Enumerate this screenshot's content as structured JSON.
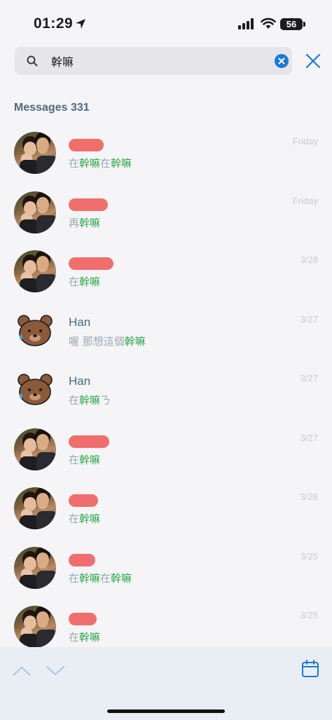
{
  "status_bar": {
    "time": "01:29",
    "battery": "56"
  },
  "search": {
    "value": "幹嘛",
    "placeholder": ""
  },
  "section": {
    "title": "Messages 331"
  },
  "messages": [
    {
      "name": "",
      "name_redacted": true,
      "avatar": "photo",
      "snippet_parts": [
        {
          "t": "在",
          "hl": false
        },
        {
          "t": "幹嘛",
          "hl": true
        },
        {
          "t": "在",
          "hl": false
        },
        {
          "t": "幹嘛",
          "hl": true
        }
      ],
      "date": "Friday"
    },
    {
      "name": "",
      "name_redacted": true,
      "avatar": "photo",
      "snippet_parts": [
        {
          "t": "再",
          "hl": false
        },
        {
          "t": "幹嘛",
          "hl": true
        }
      ],
      "date": "Friday"
    },
    {
      "name": "",
      "name_redacted": true,
      "avatar": "photo",
      "snippet_parts": [
        {
          "t": "在",
          "hl": false
        },
        {
          "t": "幹嘛",
          "hl": true
        }
      ],
      "date": "3/28"
    },
    {
      "name": "Han",
      "name_redacted": false,
      "avatar": "bear",
      "snippet_parts": [
        {
          "t": "喔 那想這個",
          "hl": false
        },
        {
          "t": "幹嘛",
          "hl": true
        }
      ],
      "date": "3/27"
    },
    {
      "name": "Han",
      "name_redacted": false,
      "avatar": "bear",
      "snippet_parts": [
        {
          "t": "在",
          "hl": false
        },
        {
          "t": "幹嘛",
          "hl": true
        },
        {
          "t": "ㄋ",
          "hl": false
        }
      ],
      "date": "3/27"
    },
    {
      "name": "",
      "name_redacted": true,
      "avatar": "photo",
      "snippet_parts": [
        {
          "t": "在",
          "hl": false
        },
        {
          "t": "幹嘛",
          "hl": true
        }
      ],
      "date": "3/27"
    },
    {
      "name": "",
      "name_redacted": true,
      "avatar": "photo",
      "snippet_parts": [
        {
          "t": "在",
          "hl": false
        },
        {
          "t": "幹嘛",
          "hl": true
        }
      ],
      "date": "3/26"
    },
    {
      "name": "",
      "name_redacted": true,
      "avatar": "photo",
      "snippet_parts": [
        {
          "t": "在",
          "hl": false
        },
        {
          "t": "幹嘛",
          "hl": true
        },
        {
          "t": "在",
          "hl": false
        },
        {
          "t": "幹嘛",
          "hl": true
        }
      ],
      "date": "3/25"
    },
    {
      "name": "",
      "name_redacted": true,
      "avatar": "photo",
      "snippet_parts": [
        {
          "t": "在",
          "hl": false
        },
        {
          "t": "幹嘛",
          "hl": true
        }
      ],
      "date": "3/25"
    }
  ],
  "colors": {
    "accent": "#1b7ad6",
    "highlight": "#2aa84a",
    "redaction": "#f06e6e",
    "section_title": "#4f6981"
  },
  "icons": {
    "search": "search-icon",
    "clear": "clear-icon",
    "close": "close-icon",
    "up": "chevron-up-icon",
    "down": "chevron-down-icon",
    "calendar": "calendar-icon"
  }
}
